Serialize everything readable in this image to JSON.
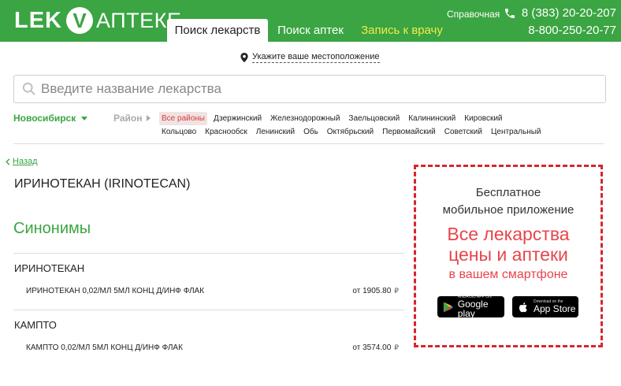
{
  "header": {
    "logo": {
      "left": "LEK",
      "mark": "V",
      "right": "АПТЕКЕ"
    },
    "tabs": [
      {
        "label": "Поиск лекарств",
        "active": true
      },
      {
        "label": "Поиск аптек",
        "active": false
      },
      {
        "label": "Запись к врачу",
        "active": false
      }
    ],
    "help_label": "Справочная",
    "phones": [
      "8 (383) 20-20-207",
      "8-800-250-20-77"
    ]
  },
  "location": {
    "label": "Укажите ваше местоположение",
    "icon": "map-pin-icon"
  },
  "search": {
    "placeholder": "Введите название лекарства",
    "value": "",
    "icon": "search-icon"
  },
  "filters": {
    "city": "Новосибирск",
    "district_label": "Район",
    "districts": [
      {
        "label": "Все районы",
        "selected": true
      },
      {
        "label": "Дзержинский"
      },
      {
        "label": "Железнодорожный"
      },
      {
        "label": "Заельцовский"
      },
      {
        "label": "Калининский"
      },
      {
        "label": "Кировский"
      },
      {
        "label": "Кольцово"
      },
      {
        "label": "Краснообск"
      },
      {
        "label": "Ленинский"
      },
      {
        "label": "Обь"
      },
      {
        "label": "Октябрьский"
      },
      {
        "label": "Первомайский"
      },
      {
        "label": "Советский"
      },
      {
        "label": "Центральный"
      }
    ]
  },
  "content": {
    "back_label": "Назад",
    "drug_title": "ИРИНОТЕКАН (IRINOTECAN)",
    "synonyms_title": "Синонимы",
    "groups": [
      {
        "name": "ИРИНОТЕКАН",
        "items": [
          {
            "name": "ИРИНОТЕКАН 0,02/МЛ 5МЛ КОНЦ Д/ИНФ ФЛАК",
            "price": "от 1905.80",
            "currency": "₽"
          }
        ]
      },
      {
        "name": "КАМПТО",
        "items": [
          {
            "name": "КАМПТО 0,02/МЛ 5МЛ КОНЦ Д/ИНФ ФЛАК",
            "price": "от 3574.00",
            "currency": "₽"
          }
        ]
      }
    ]
  },
  "promo": {
    "line1": "Бесплатное",
    "line2": "мобильное приложение",
    "red1": "Все лекарства",
    "red2": "цены и аптеки",
    "red3": "в вашем смартфоне",
    "google_play": {
      "small": "ANDROID APP ON",
      "big": "Google play"
    },
    "app_store": {
      "small": "Download on the",
      "big": "App Store"
    }
  },
  "colors": {
    "brand_green": "#3aa542",
    "accent_red": "#e8454b",
    "tab_yellow": "#f4e94a"
  }
}
